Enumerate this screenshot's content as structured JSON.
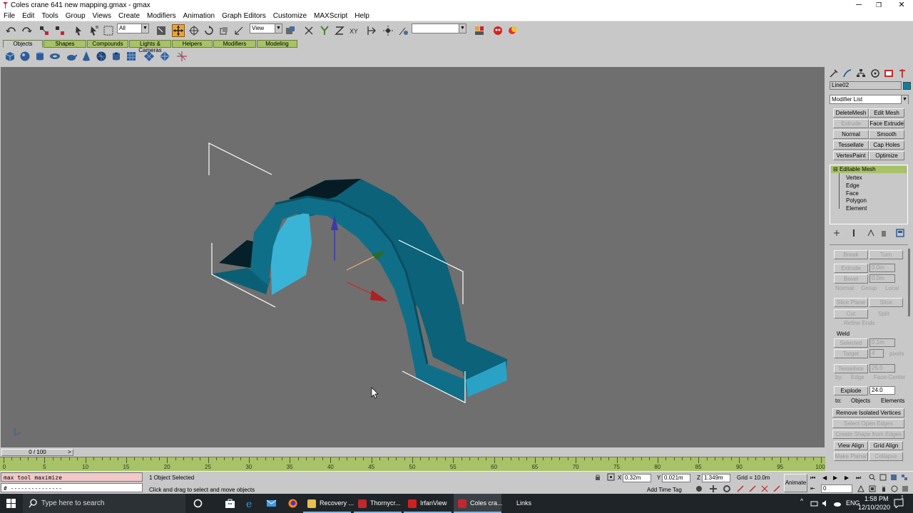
{
  "window": {
    "title": "Coles crane 641 new mapping.gmax - gmax",
    "minimize": "─",
    "restore": "❐",
    "close": "✕"
  },
  "menu": [
    "File",
    "Edit",
    "Tools",
    "Group",
    "Views",
    "Create",
    "Modifiers",
    "Animation",
    "Graph Editors",
    "Customize",
    "MAXScript",
    "Help"
  ],
  "toolbar": {
    "selection_filter": "All",
    "coord_system": "View",
    "named_selection": ""
  },
  "tabs": [
    "Objects",
    "Shapes",
    "Compounds",
    "Lights & Cameras",
    "Helpers",
    "Modifiers",
    "Modeling"
  ],
  "viewport": {
    "selected_color": "#0e6f86"
  },
  "command_panel": {
    "object_name": "Line02",
    "object_color": "#0e7fa0",
    "modifier_list": "Modifier List",
    "modifier_buttons": [
      "DeleteMesh",
      "Edit Mesh",
      "Extrude",
      "Face Extrude",
      "Normal",
      "Smooth",
      "Tessellate",
      "Cap Holes",
      "VertexPaint",
      "Optimize"
    ],
    "stack": {
      "root": "Editable Mesh",
      "expander": "⊟",
      "subobjects": [
        "Vertex",
        "Edge",
        "Face",
        "Polygon",
        "Element"
      ]
    },
    "edit_geometry": {
      "break": "Break",
      "turn": "Turn",
      "extrude": "Extrude",
      "extrude_val": "0.0m",
      "bevel": "Bevel",
      "bevel_val": "0.0m",
      "normal_label": "Normal:",
      "group": "Group",
      "local": "Local",
      "slice_plane": "Slice Plane",
      "slice": "Slice",
      "cut": "Cut",
      "split": "Split",
      "refine_ends": "Refine Ends",
      "weld_title": "Weld",
      "selected": "Selected",
      "selected_val": "0.1m",
      "target": "Target",
      "target_val": "4",
      "pixels": "pixels",
      "tessellate": "Tessellate",
      "tessellate_val": "25.0",
      "by": "by:",
      "edge": "Edge",
      "face_center": "Face-Center",
      "explode": "Explode",
      "explode_val": "24.0",
      "to": "to:",
      "objects": "Objects",
      "elements": "Elements",
      "remove_isolated": "Remove Isolated Vertices",
      "select_open_edges": "Select Open Edges",
      "create_shape": "Create Shape from Edges",
      "view_align": "View Align",
      "grid_align": "Grid Align",
      "make_planar": "Make Planar",
      "collapse": "Collapse"
    }
  },
  "timeline": {
    "frame_slider": "0 / 100",
    "ticks": [
      0,
      5,
      10,
      15,
      20,
      25,
      30,
      35,
      40,
      45,
      50,
      55,
      60,
      65,
      70,
      75,
      80,
      85,
      90,
      95,
      100
    ]
  },
  "status": {
    "listener_line1": "max tool maximize",
    "listener_line2": "# ---------------",
    "selection": "1 Object Selected",
    "prompt": "Click and drag to select and move objects",
    "x_label": "X",
    "x": "0.32m",
    "y_label": "Y",
    "y": "0.021m",
    "z_label": "Z",
    "z": "1.349m",
    "grid": "Grid = 10.0m",
    "add_time_tag": "Add Time Tag",
    "animate": "Animate",
    "current_frame": "0"
  },
  "taskbar": {
    "search_placeholder": "Type here to search",
    "items": [
      "Recovery ...",
      "Thornycr...",
      "IrfanView",
      "Coles cra..."
    ],
    "links": "Links",
    "language": "ENG",
    "time": "1:58 PM",
    "date": "12/10/2020",
    "notifications": "1"
  }
}
